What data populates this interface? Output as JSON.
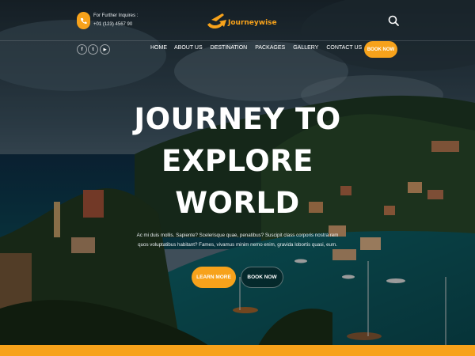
{
  "header": {
    "contact_label": "For Further Inquires :",
    "contact_phone": "+01 (123) 4567 90",
    "logo_text": "Journeywise"
  },
  "nav": {
    "social": [
      {
        "icon": "facebook-icon",
        "glyph": "f"
      },
      {
        "icon": "twitter-icon",
        "glyph": "t"
      },
      {
        "icon": "youtube-icon",
        "glyph": "▶"
      }
    ],
    "items": [
      "HOME",
      "ABOUT US",
      "DESTINATION",
      "PACKAGES",
      "GALLERY",
      "CONTACT US"
    ],
    "book_label": "BOOK NOW"
  },
  "hero": {
    "title_lines": [
      "JOURNEY TO",
      "EXPLORE",
      "WORLD"
    ],
    "description": "Ac mi duis mollis. Sapiente? Scelerisque quae, penatibus? Suscipit class corporis nostra rem quos voluptatibus habitant? Fames, vivamus minim nemo enim, gravida lobortis quasi, eum.",
    "learn_more_label": "LEARN MORE",
    "book_now_label": "BOOK NOW"
  },
  "colors": {
    "accent": "#f7a21b",
    "sea": "#0e5860"
  }
}
